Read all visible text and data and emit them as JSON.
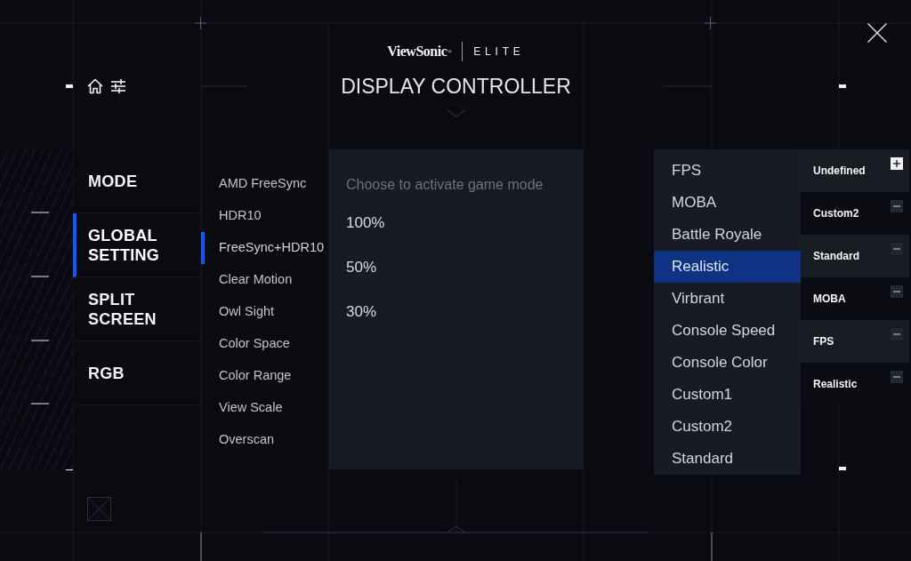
{
  "header": {
    "logo": {
      "brand": "ViewSonic$^{®}$",
      "product": "ELITE"
    },
    "title": "DISPLAY CONTROLLER"
  },
  "nav": [
    {
      "label": "MODE",
      "selected": false
    },
    {
      "label": "GLOBAL SETTING",
      "selected": true
    },
    {
      "label": "SPLIT SCREEN",
      "selected": false
    },
    {
      "label": "RGB",
      "selected": false
    }
  ],
  "submenu": [
    {
      "label": "AMD FreeSync",
      "selected": false
    },
    {
      "label": "HDR10",
      "selected": false
    },
    {
      "label": "FreeSync+HDR10",
      "selected": true
    },
    {
      "label": "Clear Motion",
      "selected": false
    },
    {
      "label": "Owl Sight",
      "selected": false
    },
    {
      "label": "Color Space",
      "selected": false
    },
    {
      "label": "Color Range",
      "selected": false
    },
    {
      "label": "View Scale",
      "selected": false
    },
    {
      "label": "Overscan",
      "selected": false
    }
  ],
  "panel": {
    "hint": "Choose to activate game mode",
    "options": [
      "100%",
      "50%",
      "30%"
    ]
  },
  "game_modes": [
    {
      "label": "FPS",
      "selected": false
    },
    {
      "label": "MOBA",
      "selected": false
    },
    {
      "label": "Battle Royale",
      "selected": false
    },
    {
      "label": "Realistic",
      "selected": true
    },
    {
      "label": "Virbrant",
      "selected": false
    },
    {
      "label": "Console Speed",
      "selected": false
    },
    {
      "label": "Console Color",
      "selected": false
    },
    {
      "label": "Custom1",
      "selected": false
    },
    {
      "label": "Custom2",
      "selected": false
    },
    {
      "label": "Standard",
      "selected": false
    }
  ],
  "presets": [
    {
      "label": "Undefined",
      "kind": "add"
    },
    {
      "label": "Custom2",
      "kind": "remove"
    },
    {
      "label": "Standard",
      "kind": "remove"
    },
    {
      "label": "MOBA",
      "kind": "remove"
    },
    {
      "label": "FPS",
      "kind": "remove"
    },
    {
      "label": "Realistic",
      "kind": "remove"
    }
  ]
}
